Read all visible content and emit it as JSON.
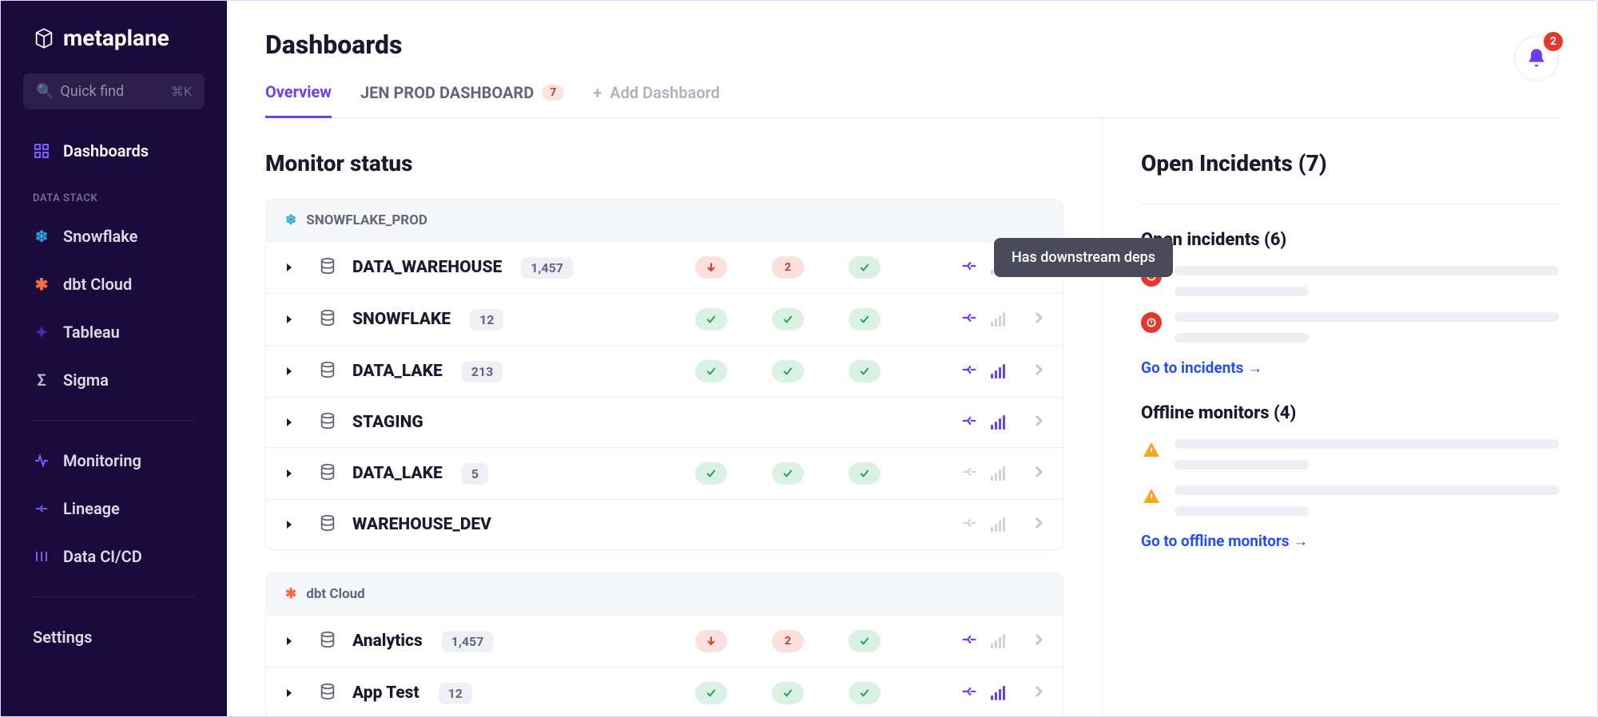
{
  "brand": {
    "name": "metaplane"
  },
  "quickfind": {
    "placeholder": "Quick find",
    "shortcut": "⌘K"
  },
  "sidebar": {
    "items": [
      {
        "label": "Dashboards",
        "icon": "grid",
        "active": true
      },
      {
        "label": "DATA STACK",
        "section": true
      },
      {
        "label": "Snowflake",
        "icon": "snowflake"
      },
      {
        "label": "dbt Cloud",
        "icon": "dbt"
      },
      {
        "label": "Tableau",
        "icon": "tableau"
      },
      {
        "label": "Sigma",
        "icon": "sigma"
      },
      {
        "label": "Monitoring",
        "icon": "pulse",
        "divider_before": true
      },
      {
        "label": "Lineage",
        "icon": "lineage"
      },
      {
        "label": "Data CI/CD",
        "icon": "cicd"
      },
      {
        "label": "Settings",
        "divider_before": true
      }
    ]
  },
  "header": {
    "title": "Dashboards",
    "tabs": [
      {
        "label": "Overview",
        "active": true
      },
      {
        "label": "JEN PROD DASHBOARD",
        "badge": "7"
      },
      {
        "label": "Add Dashbaord",
        "add": true
      }
    ],
    "notification_count": "2"
  },
  "tooltip": "Has downstream deps",
  "monitor": {
    "title": "Monitor status",
    "groups": [
      {
        "source": "SNOWFLAKE_PROD",
        "icon": "snowflake",
        "rows": [
          {
            "name": "DATA_WAREHOUSE",
            "count": "1,457",
            "statuses": [
              "error-down",
              "error-2",
              "ok"
            ],
            "deps": true,
            "bars": "muted"
          },
          {
            "name": "SNOWFLAKE",
            "count": "12",
            "statuses": [
              "ok",
              "ok",
              "ok"
            ],
            "deps": true,
            "bars": "muted"
          },
          {
            "name": "DATA_LAKE",
            "count": "213",
            "statuses": [
              "ok",
              "ok",
              "ok"
            ],
            "deps": true,
            "bars": "active"
          },
          {
            "name": "STAGING",
            "count": "",
            "statuses": [
              "",
              "",
              ""
            ],
            "deps": true,
            "bars": "active"
          },
          {
            "name": "DATA_LAKE",
            "count": "5",
            "statuses": [
              "ok",
              "ok",
              "ok"
            ],
            "deps": "muted",
            "bars": "muted"
          },
          {
            "name": "WAREHOUSE_DEV",
            "count": "",
            "statuses": [
              "",
              "",
              ""
            ],
            "deps": "muted",
            "bars": "muted"
          }
        ]
      },
      {
        "source": "dbt Cloud",
        "icon": "dbt",
        "rows": [
          {
            "name": "Analytics",
            "count": "1,457",
            "statuses": [
              "error-down",
              "error-2",
              "ok"
            ],
            "deps": true,
            "bars": "muted"
          },
          {
            "name": "App Test",
            "count": "12",
            "statuses": [
              "ok",
              "ok",
              "ok"
            ],
            "deps": true,
            "bars": "active"
          }
        ]
      }
    ]
  },
  "incidents": {
    "title": "Open Incidents (7)",
    "open": {
      "title": "Open incidents (6)",
      "link": "Go to incidents →"
    },
    "offline": {
      "title": "Offline monitors (4)",
      "link": "Go to offline monitors →"
    }
  }
}
